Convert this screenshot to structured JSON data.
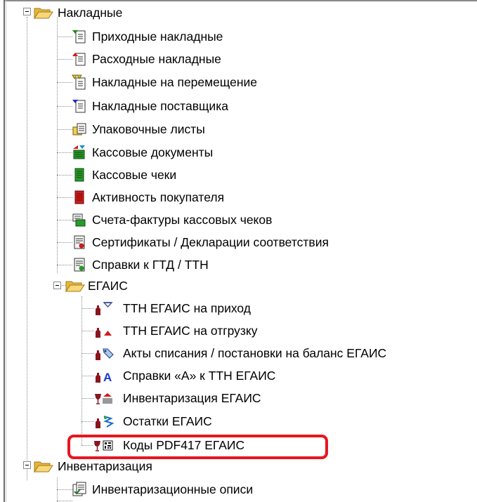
{
  "tree": {
    "nakladnye": {
      "label": "Накладные",
      "icon": "folder-open-icon",
      "children": [
        {
          "label": "Приходные накладные",
          "icon": "document-arrow-in-icon"
        },
        {
          "label": "Расходные накладные",
          "icon": "document-arrow-out-icon"
        },
        {
          "label": "Накладные на перемещение",
          "icon": "document-transfer-icon"
        },
        {
          "label": "Накладные поставщика",
          "icon": "document-supplier-icon"
        },
        {
          "label": "Упаковочные листы",
          "icon": "packing-list-icon"
        },
        {
          "label": "Кассовые документы",
          "icon": "cash-documents-icon"
        },
        {
          "label": "Кассовые чеки",
          "icon": "cash-receipt-icon"
        },
        {
          "label": "Активность покупателя",
          "icon": "customer-activity-icon"
        },
        {
          "label": "Счета-фактуры кассовых чеков",
          "icon": "invoice-receipts-icon"
        },
        {
          "label": "Сертификаты / Декларации соответствия",
          "icon": "certificate-icon"
        },
        {
          "label": "Справки к ГТД / ТТН",
          "icon": "customs-certificate-icon"
        }
      ]
    },
    "egais": {
      "label": "ЕГАИС",
      "icon": "folder-open-icon",
      "children": [
        {
          "label": "ТТН ЕГАИС на приход",
          "icon": "bottle-arrow-in-icon"
        },
        {
          "label": "ТТН ЕГАИС на отгрузку",
          "icon": "bottle-arrow-out-icon"
        },
        {
          "label": "Акты списания / постановки на баланс ЕГАИС",
          "icon": "bottle-act-icon"
        },
        {
          "label": "Справки «А» к ТТН ЕГАИС",
          "icon": "bottle-certificate-a-icon"
        },
        {
          "label": "Инвентаризация ЕГАИС",
          "icon": "glass-inventory-icon"
        },
        {
          "label": "Остатки ЕГАИС",
          "icon": "bottle-stock-icon"
        },
        {
          "label": "Коды PDF417 ЕГАИС",
          "icon": "barcode-pdf417-icon"
        }
      ]
    },
    "inventory": {
      "label": "Инвентаризация",
      "icon": "folder-open-icon",
      "children": [
        {
          "label": "Инвентаризационные описи",
          "icon": "inventory-list-icon"
        }
      ]
    }
  },
  "colors": {
    "highlight": "#e8151e",
    "folder": "#f2c94c",
    "tree_lines": "#8c8c8c"
  }
}
